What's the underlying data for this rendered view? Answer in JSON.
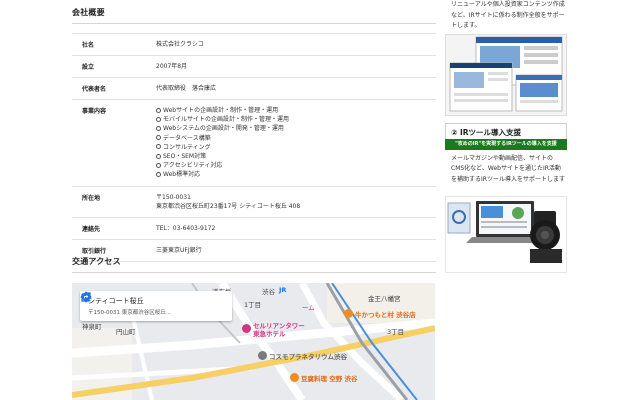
{
  "overview": {
    "title": "会社概要",
    "rows": [
      {
        "label": "社名",
        "value": "株式会社クラシコ"
      },
      {
        "label": "設立",
        "value": "2007年8月"
      },
      {
        "label": "代表者名",
        "value": "代表取締役　落合康広"
      },
      {
        "label": "事業内容",
        "items": [
          "Webサイトの企画設計・制作・管理・運用",
          "モバイルサイトの企画設計・制作・管理・運用",
          "Webシステムの企画設計・開発・管理・運用",
          "データベース構築",
          "コンサルティング",
          "SEO・SEM対策",
          "アクセシビリティ対応",
          "Web標準対応"
        ]
      },
      {
        "label": "所在地",
        "value_line1": "〒150-0031",
        "value_line2": "東京都渋谷区桜丘町23番17号 シティコート桜丘 408"
      },
      {
        "label": "連絡先",
        "value": "TEL：03-6403-9172"
      },
      {
        "label": "取引銀行",
        "value": "三菱東京UFJ銀行"
      }
    ]
  },
  "access": {
    "title": "交通アクセス"
  },
  "map": {
    "place_name": "シティコート桜丘",
    "address": "〒150-0031 東京都渋谷区桜丘...",
    "labels": {
      "shibuya": "渋谷",
      "kanasen": "金王八幡宮",
      "jinnan": "神泉町",
      "maruyama": "円山町",
      "chome1": "1丁目",
      "chome3": "3丁目",
      "jr": "JR",
      "cerulean": "セルリアンタワー\n東急ホテル",
      "cosmo": "コスモプラネタリウム渋谷",
      "toufu": "豆腐料理 空野 渋谷",
      "katsu": "牛かつもと村 渋谷店",
      "dogenzaka": "道玄坂",
      "gym": "ーム"
    }
  },
  "sidebar": {
    "intro": "リニューアルや個人投資家コンテンツ作成など、IRサイトに係わる制作全般をサポートします。",
    "heading": "② IRツール導入支援",
    "banner": "\"攻めのIR\"を実現するIRツールの導入を支援",
    "desc": "メールマガジンや動画配信、サイトのCMS化など、Webサイトを通じたIR活動を補助するIRツール導入をサポートします",
    "colors": {
      "banner": "#1b7a1f"
    }
  }
}
